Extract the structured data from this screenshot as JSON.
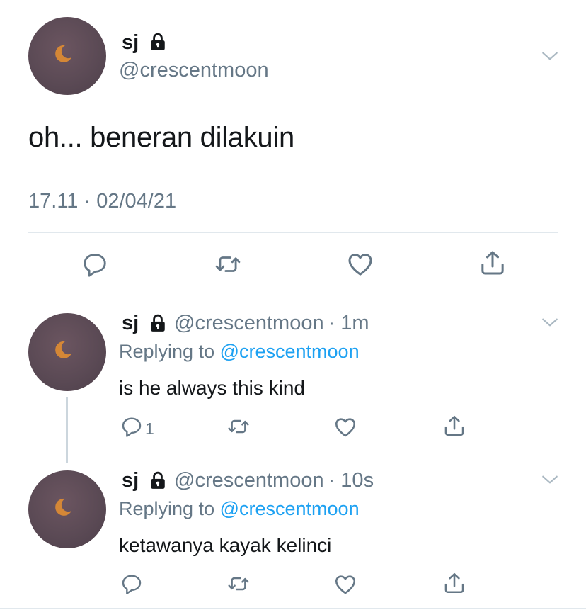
{
  "main_tweet": {
    "display_name": "sj",
    "handle": "@crescentmoon",
    "text": "oh... beneran dilakuin",
    "timestamp": "17.11 · 02/04/21"
  },
  "replies": [
    {
      "display_name": "sj",
      "handle": "@crescentmoon",
      "time": "· 1m",
      "replying_prefix": "Replying to ",
      "replying_to": "@crescentmoon",
      "text": "is he always this kind",
      "reply_count": "1"
    },
    {
      "display_name": "sj",
      "handle": "@crescentmoon",
      "time": "· 10s",
      "replying_prefix": "Replying to ",
      "replying_to": "@crescentmoon",
      "text": "ketawanya kayak kelinci",
      "reply_count": ""
    }
  ],
  "icons": {
    "lock": "lock-icon",
    "chevron": "chevron-down-icon",
    "reply": "reply-icon",
    "retweet": "retweet-icon",
    "like": "heart-icon",
    "share": "share-icon"
  },
  "colors": {
    "text": "#14171a",
    "secondary": "#657786",
    "link": "#1da1f2",
    "divider": "#e1e8ed",
    "avatar": "#5b4a55",
    "moon": "#e8902f"
  }
}
